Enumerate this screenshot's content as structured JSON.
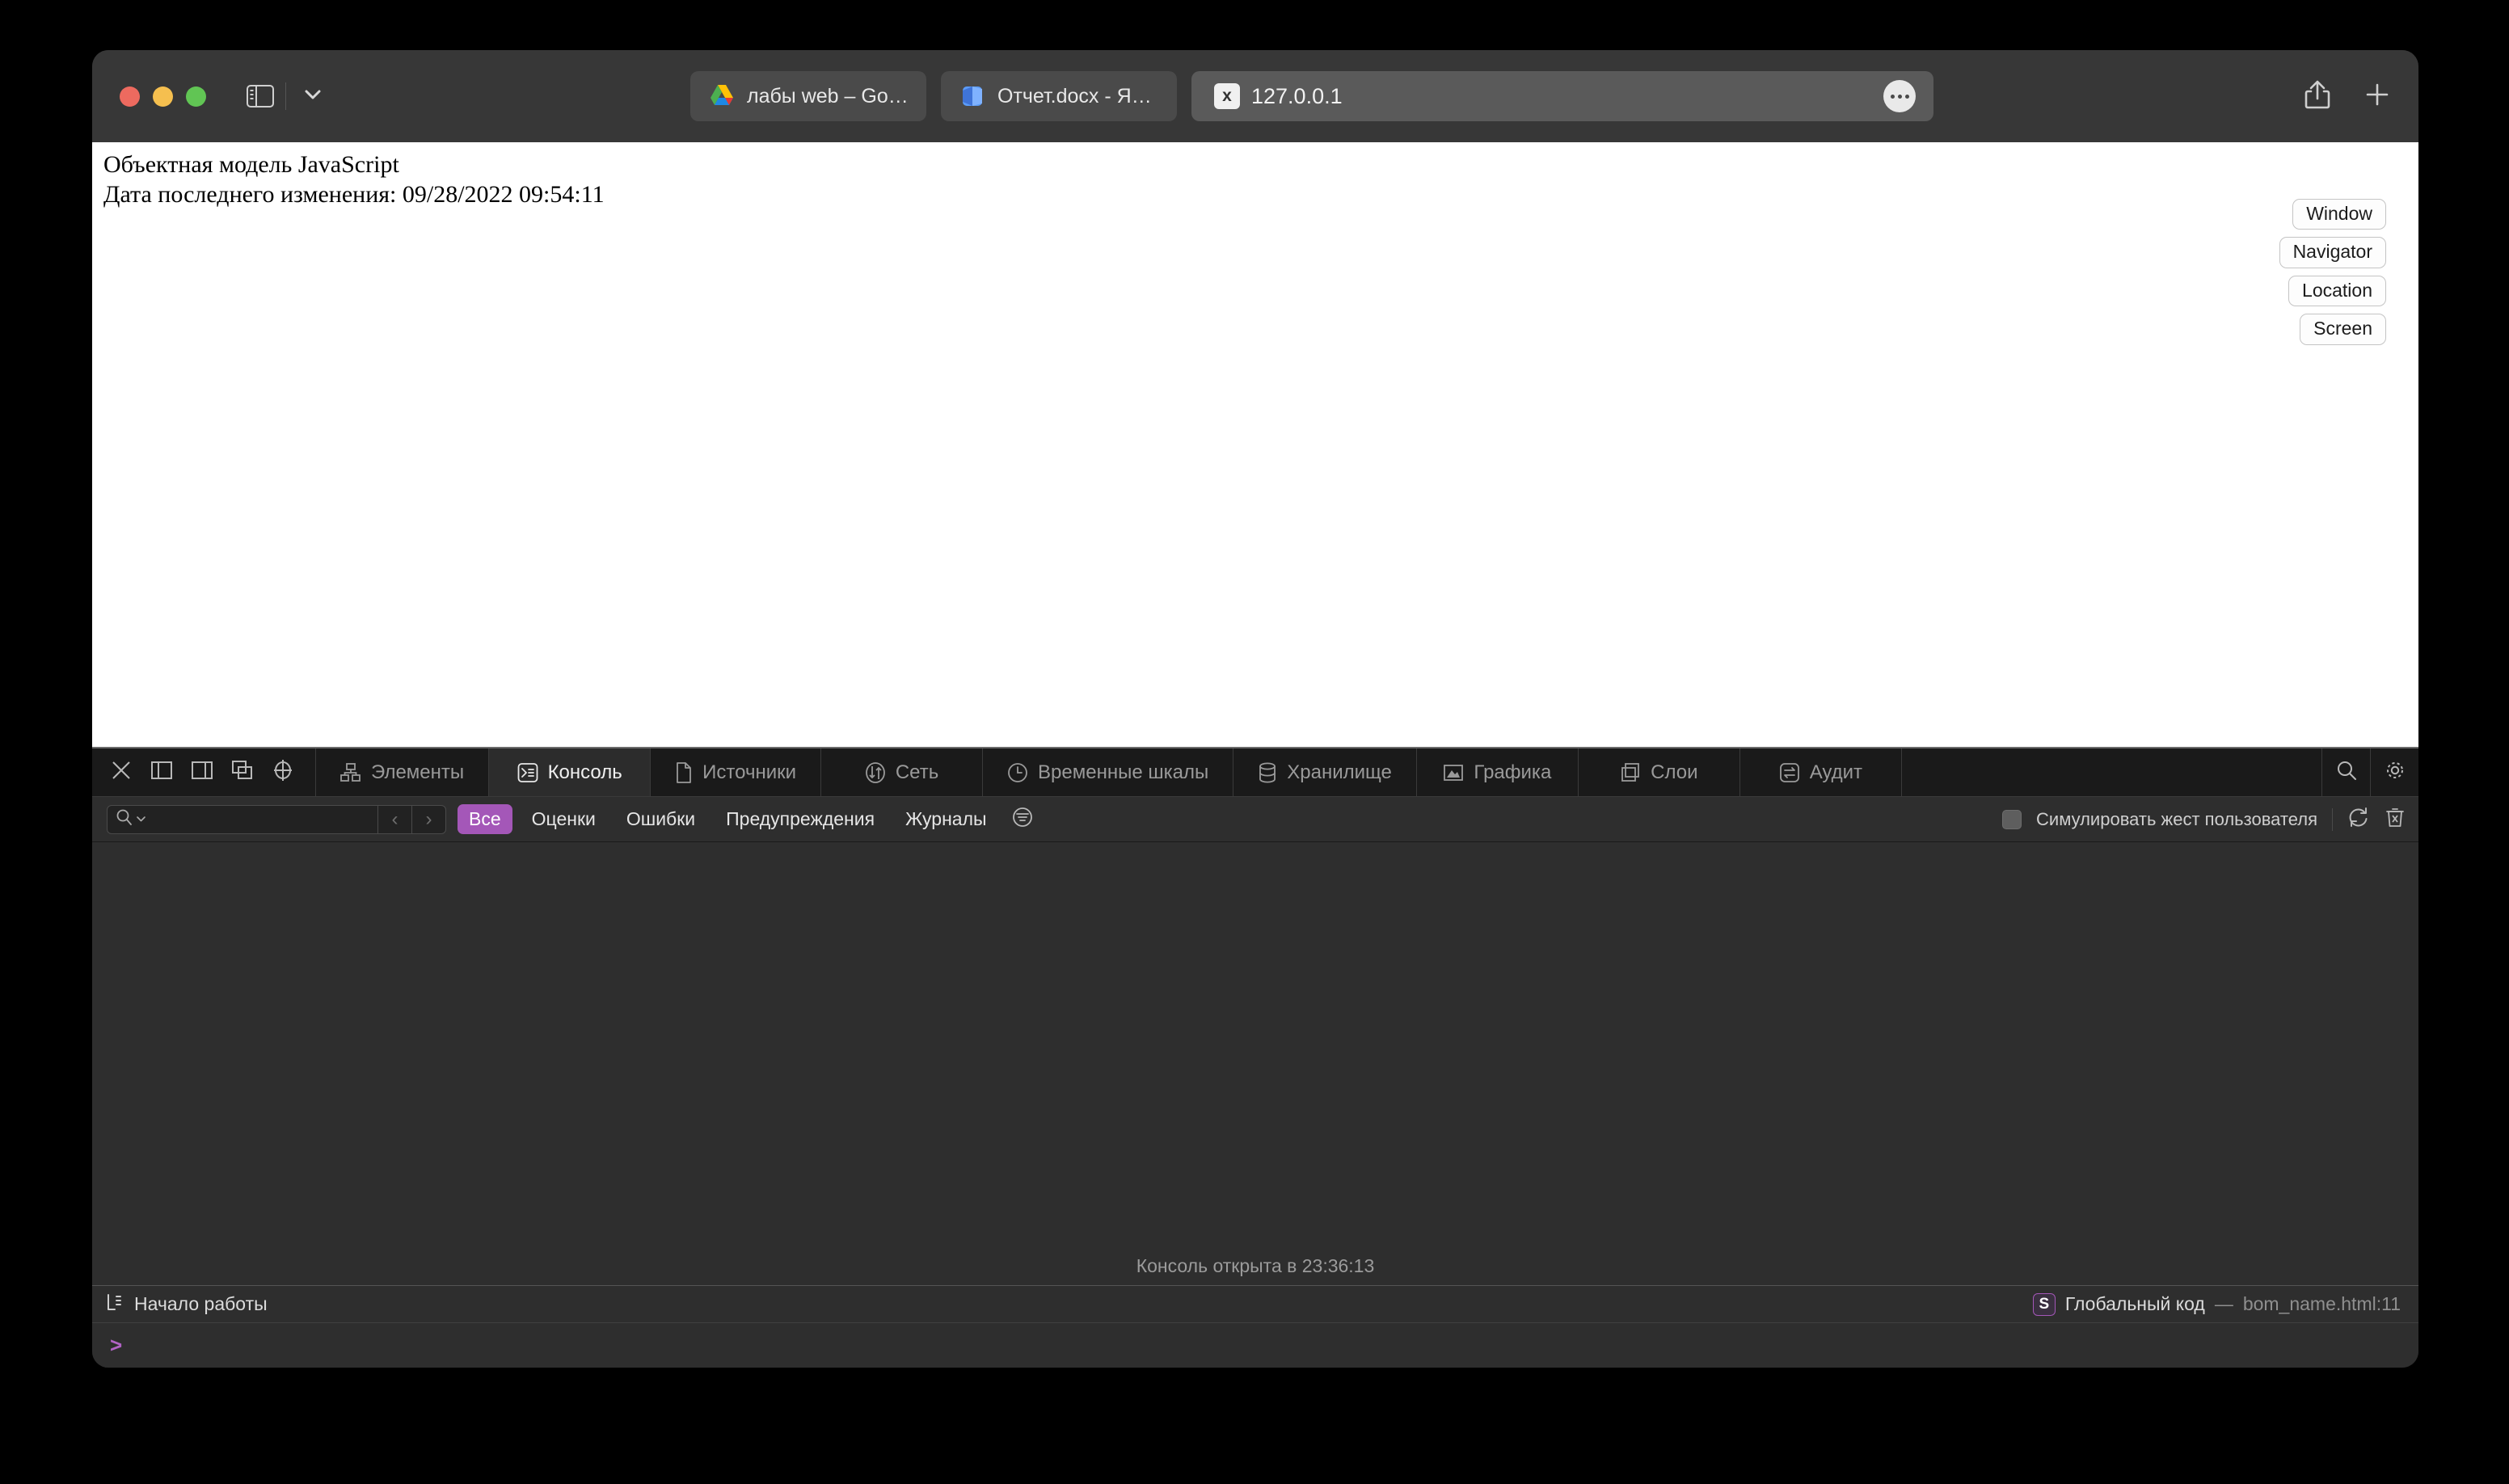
{
  "browser": {
    "window_controls": [
      "close",
      "minimize",
      "zoom"
    ],
    "sidebar_icon": "sidebar-icon",
    "chevron_icon": "chevron-down-icon",
    "share_icon": "share-icon",
    "newtab_icon": "plus-icon",
    "tabs": [
      {
        "title": "лабы web – Goo...",
        "favicon": "google-drive-icon",
        "active": false
      },
      {
        "title": "Отчет.docx - Янд...",
        "favicon": "yandex-docs-icon",
        "active": false
      },
      {
        "title": "127.0.0.1",
        "favicon": "x-favicon",
        "active": true,
        "menu_icon": "ellipsis-icon"
      }
    ]
  },
  "page": {
    "heading": "Объектная модель JavaScript",
    "modified_line": "Дата последнего изменения: 09/28/2022 09:54:11",
    "buttons": [
      {
        "label": "Window"
      },
      {
        "label": "Navigator"
      },
      {
        "label": "Location"
      },
      {
        "label": "Screen"
      }
    ]
  },
  "devtools": {
    "controls": [
      {
        "name": "close-devtools",
        "icon": "close-icon"
      },
      {
        "name": "dock-left",
        "icon": "dock-left-icon"
      },
      {
        "name": "dock-bottom",
        "icon": "dock-bottom-icon"
      },
      {
        "name": "undock",
        "icon": "undock-icon"
      },
      {
        "name": "inspect-element",
        "icon": "crosshair-icon"
      }
    ],
    "tabs": [
      {
        "label": "Элементы",
        "icon": "elements-icon",
        "selected": false
      },
      {
        "label": "Консоль",
        "icon": "console-icon",
        "selected": true
      },
      {
        "label": "Источники",
        "icon": "sources-icon",
        "selected": false
      },
      {
        "label": "Сеть",
        "icon": "network-icon",
        "selected": false
      },
      {
        "label": "Временные шкалы",
        "icon": "timelines-icon",
        "selected": false
      },
      {
        "label": "Хранилище",
        "icon": "storage-icon",
        "selected": false
      },
      {
        "label": "Графика",
        "icon": "graphics-icon",
        "selected": false
      },
      {
        "label": "Слои",
        "icon": "layers-icon",
        "selected": false
      },
      {
        "label": "Аудит",
        "icon": "audit-icon",
        "selected": false
      }
    ],
    "right_icons": [
      {
        "name": "search-devtools",
        "icon": "search-icon"
      },
      {
        "name": "devtools-settings",
        "icon": "gear-icon"
      }
    ],
    "filterbar": {
      "search_placeholder": "",
      "search_value": "",
      "search_icon": "search-icon",
      "search_dropdown_icon": "chevron-down-icon",
      "prev_icon": "chevron-left-icon",
      "next_icon": "chevron-right-icon",
      "filters": [
        {
          "label": "Все",
          "active": true
        },
        {
          "label": "Оценки",
          "active": false
        },
        {
          "label": "Ошибки",
          "active": false
        },
        {
          "label": "Предупреждения",
          "active": false
        },
        {
          "label": "Журналы",
          "active": false
        }
      ],
      "options_icon": "filter-lines-icon",
      "simulate_gesture_label": "Симулировать жест пользователя",
      "simulate_gesture_checked": false,
      "preserve_log_icon": "refresh-icon",
      "clear_console_icon": "trash-x-icon"
    },
    "console": {
      "opened_message": "Консоль открыта в 23:36:13",
      "prompt_symbol": ">"
    },
    "statusbar": {
      "left_icon": "console-prompt-icon",
      "left_label": "Начало работы",
      "badge": "S",
      "scope_label": "Глобальный код",
      "separator": "—",
      "source_label": "bom_name.html:11"
    }
  },
  "colors": {
    "accent_purple": "#a457b8",
    "toolbar_bg": "#373737",
    "devtools_bg": "#2e2e2e",
    "tabbar_bg": "#1a1a1a"
  }
}
